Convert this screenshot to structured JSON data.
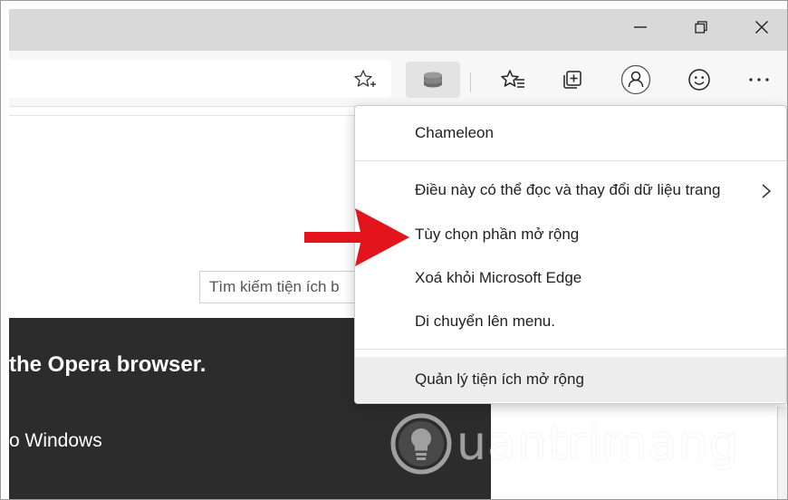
{
  "menu": {
    "header": "Chameleon",
    "items": [
      {
        "label": "Điều này có thể đọc và thay đổi dữ liệu trang"
      },
      {
        "label": "Tùy chọn phần mở rộng"
      },
      {
        "label": "Xoá khỏi Microsoft Edge"
      },
      {
        "label": "Di chuyển lên menu."
      },
      {
        "label": "Quản lý tiện ích mở rộng"
      }
    ]
  },
  "page": {
    "search_placeholder": "Tìm kiếm tiện ích b",
    "banner_title": "the Opera browser.",
    "banner_subtitle": "o Windows"
  },
  "watermark": {
    "text": "uantrimang"
  },
  "icons": {
    "minimize": "minimize-icon",
    "restore": "restore-icon",
    "close": "close-icon",
    "star": "star-add-icon",
    "extension": "chameleon-extension-icon",
    "favorites": "favorites-icon",
    "collections": "collections-icon",
    "profile": "profile-icon",
    "feedback": "emoji-icon",
    "more": "more-icon"
  },
  "colors": {
    "arrow": "#e3141b",
    "banner": "#2c2c2c",
    "hover": "#ededed"
  }
}
